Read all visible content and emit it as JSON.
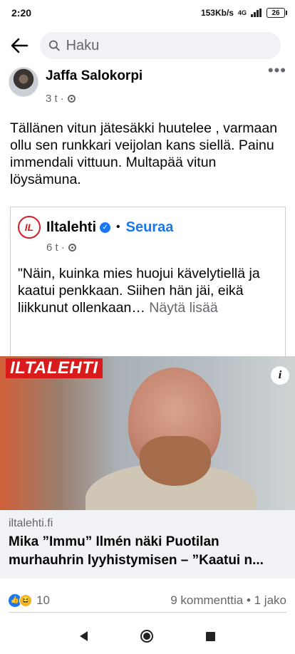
{
  "status_bar": {
    "time": "2:20",
    "net_speed": "153Kb/s",
    "network": "4G",
    "battery": "26"
  },
  "header": {
    "search_placeholder": "Haku"
  },
  "post": {
    "author": "Jaffa Salokorpi",
    "time_ago": "3 t",
    "audience_icon": "gear-icon",
    "text": "Tällänen vitun jätesäkki huutelee , varmaan ollu sen runkkari veijolan kans siellä. Painu immendali vittuun. Multapää vitun löysämuna."
  },
  "shared_post": {
    "page_logo_text": "IL",
    "page_name": "Iltalehti",
    "follow": "Seuraa",
    "time_ago": "6 t",
    "text": "\"Näin, kuinka mies huojui kävelytiellä ja kaatui penkkaan. Siihen hän jäi, eikä liikkunut ollenkaan…",
    "see_more": "Näytä lisää"
  },
  "article": {
    "image_brand": "ILTALEHTI",
    "info": "i",
    "domain": "iltalehti.fi",
    "title": "Mika ”Immu” Ilmén näki Puotilan murhauhrin lyyhistymisen – ”Kaatui n..."
  },
  "engagement": {
    "reaction_count": "10",
    "comments_shares": "9 kommenttia • 1 jako"
  },
  "colors": {
    "accent": "#1877f2",
    "brand_red": "#d91b1b",
    "secondary_text": "#65676b"
  }
}
